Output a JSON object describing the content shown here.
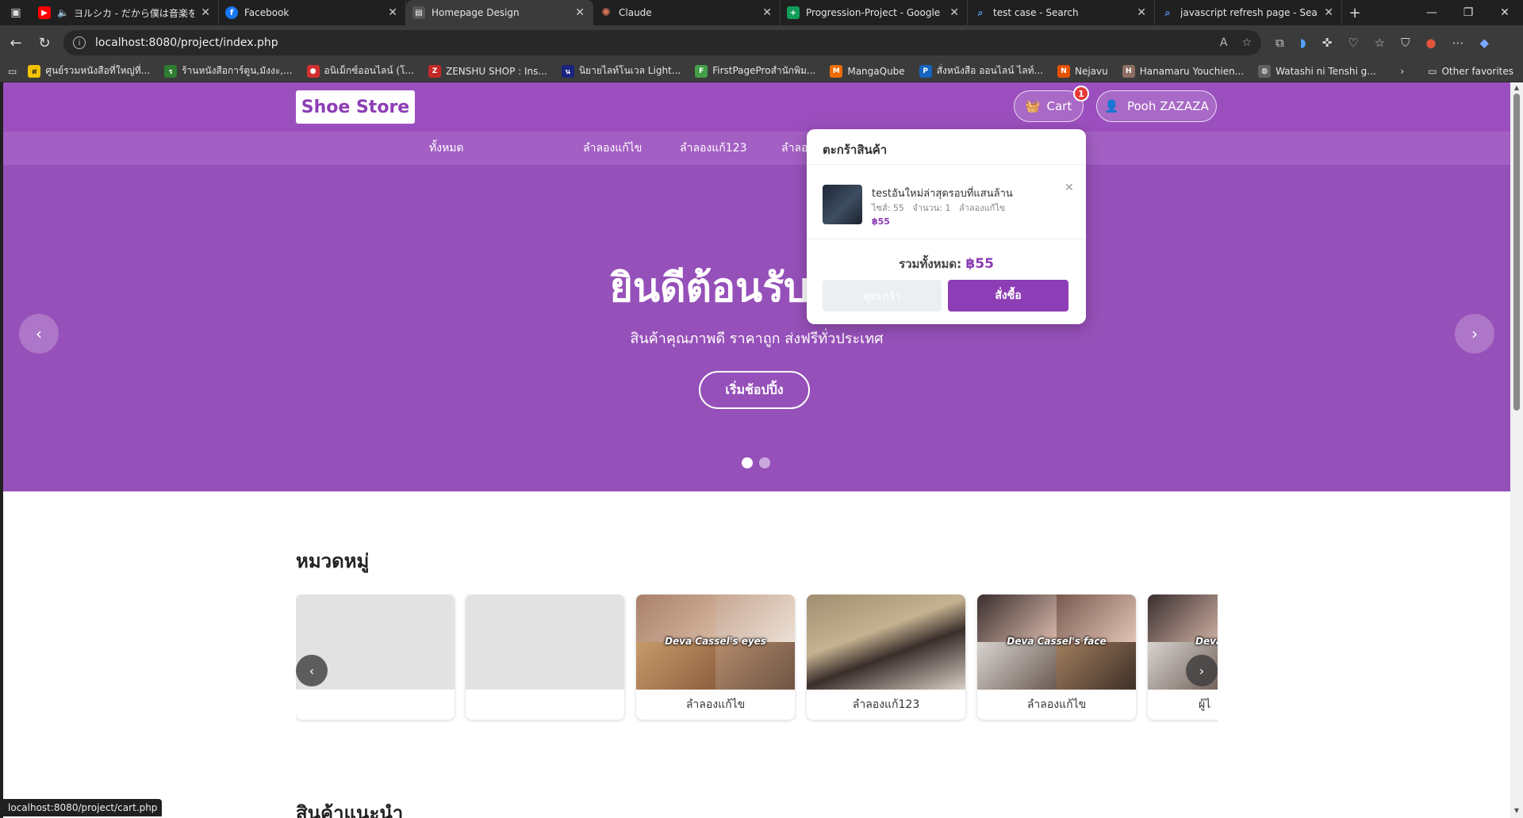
{
  "browser": {
    "tabs": [
      {
        "title": "ヨルシカ - だから僕は音楽を辞め",
        "icon": "youtube-icon",
        "color": "#ff0000"
      },
      {
        "title": "Facebook",
        "icon": "facebook-icon",
        "color": "#1877f2"
      },
      {
        "title": "Homepage Design",
        "icon": "page-icon",
        "color": "#555555"
      },
      {
        "title": "Claude",
        "icon": "claude-icon",
        "color": "#d97757"
      },
      {
        "title": "Progression-Project - Google ชีต",
        "icon": "sheets-icon",
        "color": "#0f9d58"
      },
      {
        "title": "test case - Search",
        "icon": "search-icon",
        "color": "#2b6dd6"
      },
      {
        "title": "javascript refresh page - Search",
        "icon": "search-icon",
        "color": "#2b6dd6"
      }
    ],
    "url": "localhost:8080/project/index.php",
    "bookmarks": [
      "ศูนย์รวมหนังสือที่ใหญ่ที่...",
      "ร้านหนังสือการ์ตูน,มังงะ,...",
      "อนิเม็กซ์ออนไลน์ (โ...",
      "ZENSHU SHOP : Ins...",
      "นิยายไลท์โนเวล Light...",
      "FirstPageProสำนักพิม...",
      "MangaQube",
      "สั่งหนังสือ ออนไลน์ ไลท์...",
      "Nejavu",
      "Hanamaru Youchien...",
      "Watashi ni Tenshi g..."
    ],
    "other_favorites": "Other favorites",
    "status_url": "localhost:8080/project/cart.php"
  },
  "site": {
    "logo": "Shoe Store",
    "cart_label": "Cart",
    "cart_count": "1",
    "user_name": "Pooh ZAZAZA",
    "nav": [
      "ทั้งหมด",
      "ลำลองแก้ไข",
      "ลำลองแก้123",
      "ลำลอ"
    ]
  },
  "hero": {
    "title": "ยินดีต้อนรับสู่ร้าน",
    "subtitle": "สินค้าคุณภาพดี ราคาถูก ส่งฟรีทั่วประเทศ",
    "cta": "เริ่มช้อปปิ้ง",
    "prev": "‹",
    "next": "›"
  },
  "categories": {
    "title": "หมวดหมู่",
    "items": [
      {
        "label": ""
      },
      {
        "label": ""
      },
      {
        "label": "ลำลองแก้ไข",
        "caption": "Deva Cassel's eyes"
      },
      {
        "label": "ลำลองแก้123"
      },
      {
        "label": "ลำลองแก้ไข",
        "caption": "Deva Cassel's face"
      },
      {
        "label": "ผู้ไ",
        "caption": "Deva C"
      }
    ]
  },
  "recommended": {
    "title": "สินค้าแนะนำ"
  },
  "cart_popup": {
    "title": "ตะกร้าสินค้า",
    "item": {
      "name": "testอันใหม่ล่าสุดรอบที่แสนล้าน",
      "meta": "ไซส์: 55   จำนวน: 1   ลำลองแก้ไข",
      "price": "฿55"
    },
    "total_label": "รวมทั้งหมด: ",
    "total_amount": "฿55",
    "view_cart": "ดูตะกร้า",
    "order": "สั่งซื้อ"
  },
  "colors": {
    "brand": "#9b4fbe",
    "accent": "#8d3db5",
    "badge": "#e53935"
  }
}
